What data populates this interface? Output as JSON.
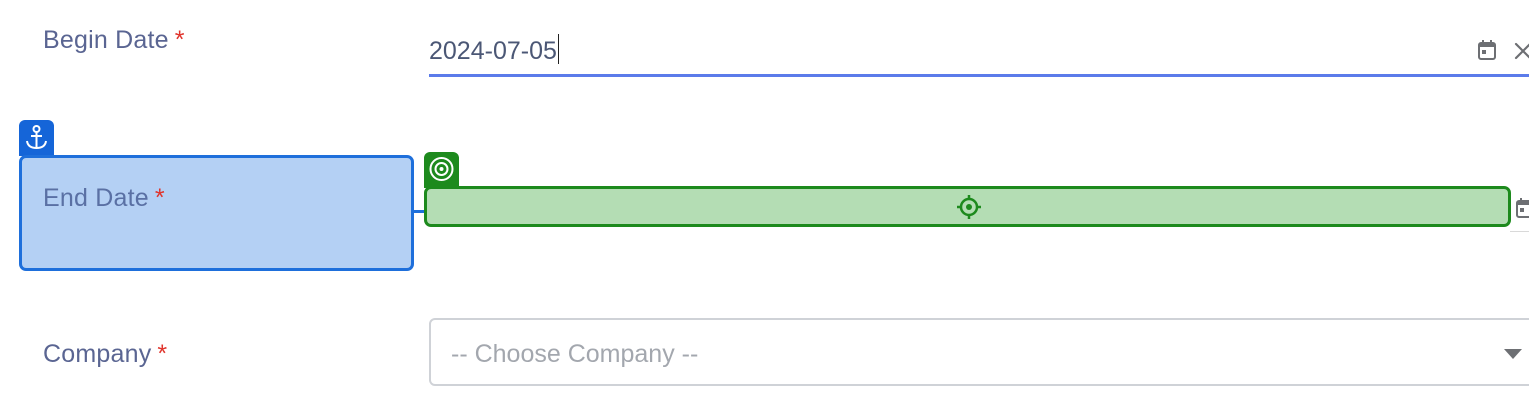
{
  "form": {
    "begin_date": {
      "label": "Begin Date",
      "required_mark": "*",
      "value": "2024-07-05"
    },
    "end_date": {
      "label": "End Date",
      "required_mark": "*",
      "value": ""
    },
    "company": {
      "label": "Company",
      "required_mark": "*",
      "placeholder": "-- Choose Company --"
    }
  },
  "icons": {
    "calendar": "calendar-icon",
    "clear": "close-icon",
    "anchor": "anchor-icon",
    "target": "target-icon",
    "crosshair": "crosshair-icon",
    "dropdown": "caret-down-icon"
  },
  "colors": {
    "label": "#5a6592",
    "required": "#e0342c",
    "focus_underline": "#5b7bea",
    "anchor_highlight": "#1e6fdb",
    "target_highlight": "#1d8a1d"
  }
}
